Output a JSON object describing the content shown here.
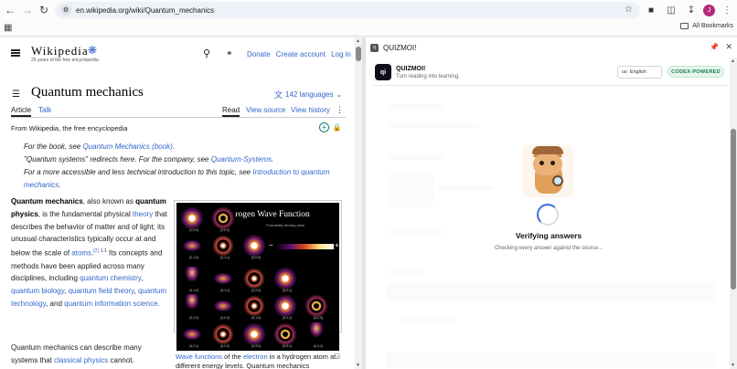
{
  "browser": {
    "url": "en.wikipedia.org/wiki/Quantum_mechanics",
    "bookmarks_label": "All Bookmarks",
    "avatar_letter": "J"
  },
  "wiki": {
    "logo": "Wikipedia",
    "tagline": "25 years of the free encyclopedia",
    "header_links": [
      "Donate",
      "Create account",
      "Log in"
    ],
    "title": "Quantum mechanics",
    "languages": "142 languages",
    "tabs": {
      "article": "Article",
      "talk": "Talk",
      "read": "Read",
      "view_source": "View source",
      "view_history": "View history"
    },
    "from": "From Wikipedia, the free encyclopedia",
    "hatnote": {
      "l1_pre": "For the book, see ",
      "l1_link": "Quantum Mechanics (book)",
      "l1_post": ".",
      "l2_pre": "\"Quantum systems\" redirects here. For the company, see ",
      "l2_link": "Quantum-Systems",
      "l2_post": ".",
      "l3_pre": "For a more accessible and less technical introduction to this topic, see ",
      "l3_link": "Introduction to quantum mechanics",
      "l3_post": "."
    },
    "lead": {
      "t1": "Quantum mechanics",
      "t2": ", also known as ",
      "t3": "quantum physics",
      "t4": ", is the fundamental physical ",
      "t5": "theory",
      "t6": " that describes the behavior of matter and of light; its unusual characteristics typically occur at and below the scale of ",
      "t7": "atoms",
      "t8": ".",
      "ref": "[2]",
      "page": "1.1",
      "t9": " Its concepts and methods have been applied across many disciplines, including ",
      "t10": "quantum chemistry",
      "t11": ", ",
      "t12": "quantum biology",
      "t13": ", ",
      "t14": "quantum field theory",
      "t15": ", ",
      "t16": "quantum technology",
      "t17": ", and ",
      "t18": "quantum information science",
      "t19": "."
    },
    "second": {
      "t1": "Quantum mechanics can describe many systems that ",
      "t2": "classical physics",
      "t3": " cannot."
    },
    "figure": {
      "title": "Hydrogen Wave Function",
      "subtitle": "Probability density plots",
      "caption_link1": "Wave functions",
      "caption_mid": " of the ",
      "caption_link2": "electron",
      "caption_post": " in a hydrogen atom at different energy levels. Quantum mechanics",
      "labels": [
        "(1,0,0)",
        "(2,0,0)",
        "(2,1,0)",
        "(2,1,1)",
        "(3,0,0)",
        "(3,1,0)",
        "(3,1,1)",
        "(3,2,0)",
        "(3,2,1)",
        "(3,2,2)",
        "(4,0,0)",
        "(4,1,0)",
        "(4,1,1)",
        "(4,2,0)",
        "(4,2,1)",
        "(4,2,2)",
        "(4,3,0)",
        "(4,3,1)",
        "(4,3,2)",
        "(4,3,3)",
        "(4,3,0)"
      ]
    }
  },
  "panel": {
    "header_title": "QUIZMOI!",
    "app_logo": "qi",
    "app_name": "QUIZMOI!",
    "app_tagline": "Turn reading into learning.",
    "language": "English",
    "language_flag": "us",
    "badge": "CODEX-POWERED",
    "status_title": "Verifying answers",
    "status_sub": "Checking every answer against the source..."
  },
  "colors": {
    "link": "#3366cc",
    "badge_bg": "#e6f6ee",
    "badge_fg": "#137a47",
    "spinner": "#3b6fd8"
  },
  "icons": [
    "back-icon",
    "forward-icon",
    "reload-icon",
    "site-info-icon",
    "star-icon",
    "extensions-icon",
    "side-panel-icon",
    "download-icon",
    "menu-icon",
    "apps-icon",
    "folder-icon",
    "hamburger-icon",
    "search-icon",
    "reading-glasses-icon",
    "toc-icon",
    "translate-icon",
    "chevron-down-icon",
    "more-icon",
    "add-icon",
    "lock-icon",
    "enlarge-icon",
    "pin-icon",
    "close-icon"
  ]
}
